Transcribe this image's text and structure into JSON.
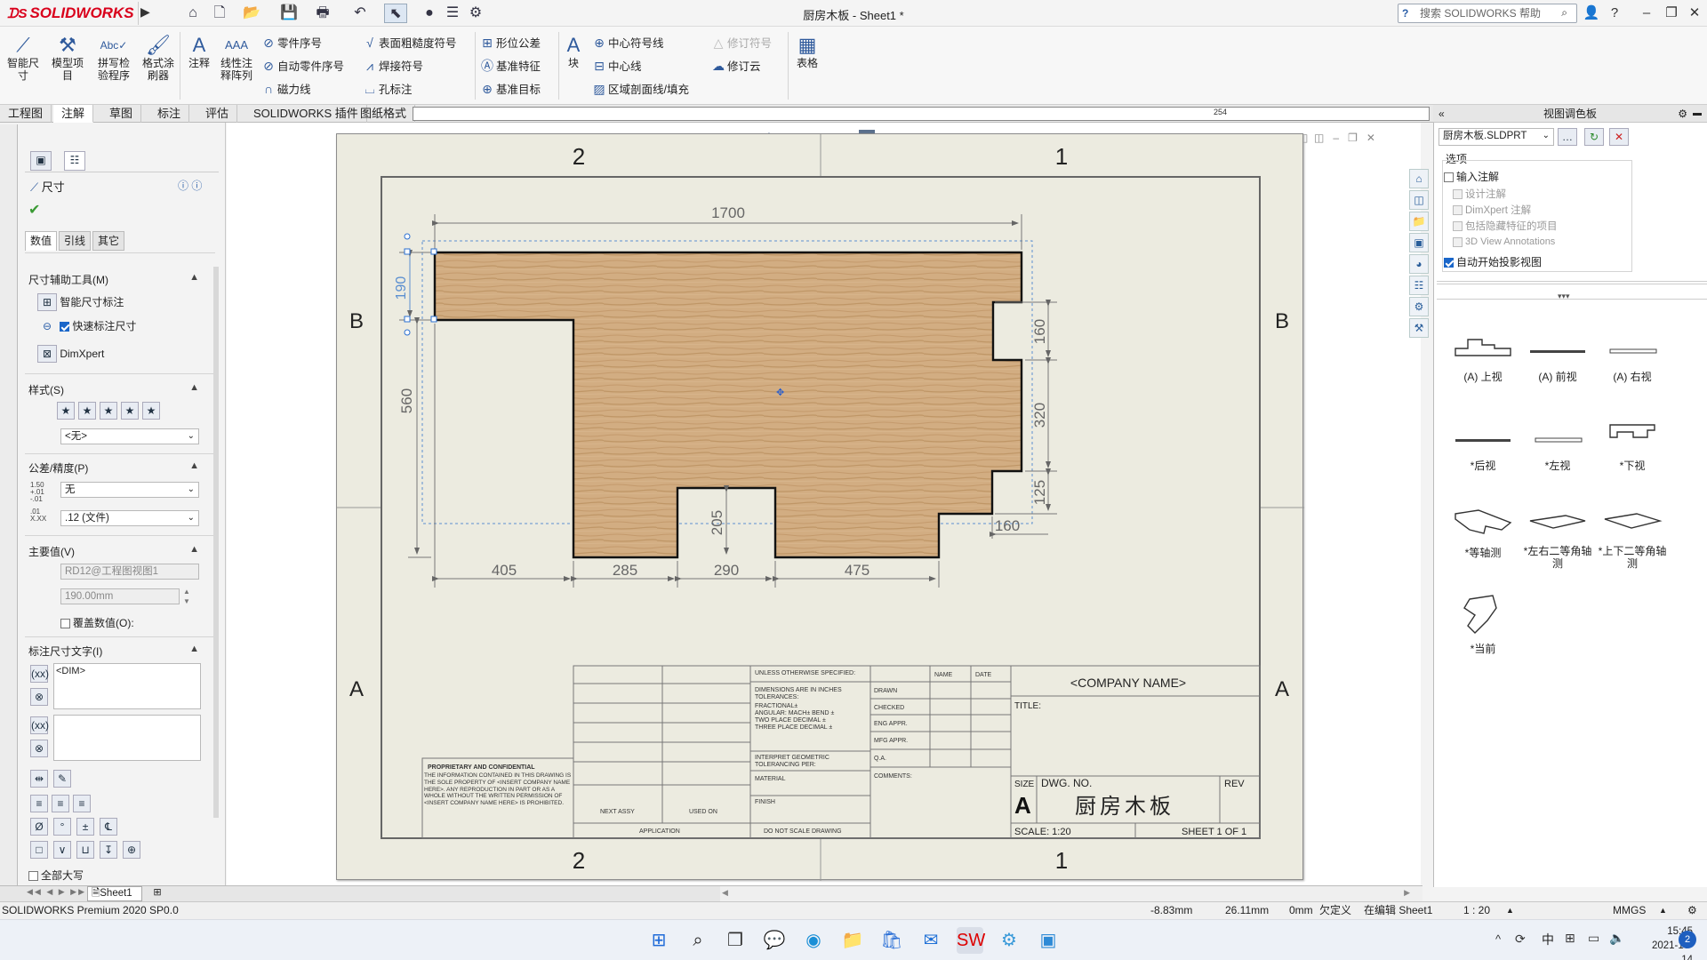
{
  "app": {
    "logo": "SOLIDWORKS",
    "doc_title": "厨房木板 - Sheet1 *",
    "help_placeholder": "搜索 SOLIDWORKS 帮助"
  },
  "ribbon": {
    "big": [
      {
        "label": "智能尺\n寸",
        "icon": "smart-dimension"
      },
      {
        "label": "模型项\n目",
        "icon": "model-items"
      },
      {
        "label": "拼写检\n验程序",
        "icon": "spell-check"
      },
      {
        "label": "格式涂\n刷器",
        "icon": "format-painter"
      },
      {
        "label": "注释",
        "icon": "note"
      },
      {
        "label": "线性注\n释阵列",
        "icon": "linear-note-pattern"
      }
    ],
    "col1": [
      "零件序号",
      "自动零件序号",
      "磁力线"
    ],
    "col2": [
      "表面粗糙度符号",
      "焊接符号",
      "孔标注"
    ],
    "col3": [
      "形位公差",
      "基准特征",
      "基准目标"
    ],
    "block_label": "块",
    "col4": [
      "中心符号线",
      "中心线",
      "区域剖面线/填充"
    ],
    "col5": [
      "修订符号",
      "修订云"
    ],
    "table_label": "表格"
  },
  "tabs": [
    "工程图",
    "注解",
    "草图",
    "标注",
    "评估",
    "SOLIDWORKS 插件",
    "图纸格式"
  ],
  "active_tab": "注解",
  "ruler_mark": "254",
  "left_panel": {
    "title": "尺寸",
    "subtabs": [
      "数值",
      "引线",
      "其它"
    ],
    "helper_title": "尺寸辅助工具(M)",
    "helper_items": [
      "智能尺寸标注",
      "快速标注尺寸",
      "DimXpert"
    ],
    "style_title": "样式(S)",
    "style_value": "<无>",
    "tol_title": "公差/精度(P)",
    "tol_value": "无",
    "prec_value": ".12 (文件)",
    "primary_title": "主要值(V)",
    "primary_ref": "RD12@工程图视图1",
    "primary_val": "190.00mm",
    "override_label": "覆盖数值(O):",
    "dimtext_title": "标注尺寸文字(I)",
    "dimtext_value": "<DIM>",
    "allcaps_label": "全部大写"
  },
  "drawing": {
    "zone_top": [
      "2",
      "1"
    ],
    "zone_side": [
      "B",
      "A"
    ],
    "dims": {
      "top": "1700",
      "left_small": "190",
      "left": "560",
      "right1": "160",
      "right2": "320",
      "right3": "125",
      "bottom_right": "160",
      "notch": "205",
      "b1": "405",
      "b2": "285",
      "b3": "290",
      "b4": "475"
    },
    "tb": {
      "unless": "UNLESS OTHERWISE SPECIFIED:",
      "dims_in": "DIMENSIONS ARE IN INCHES",
      "tolerances": "TOLERANCES:",
      "fractional": "FRACTIONAL±",
      "angular": "ANGULAR: MACH±    BEND ±",
      "two_place": "TWO PLACE DECIMAL   ±",
      "three_place": "THREE PLACE DECIMAL  ±",
      "interpret": "INTERPRET GEOMETRIC",
      "tolerancing": "TOLERANCING PER:",
      "material": "MATERIAL",
      "finish": "FINISH",
      "next_assy": "NEXT ASSY",
      "used_on": "USED ON",
      "application": "APPLICATION",
      "do_not_scale": "DO NOT SCALE DRAWING",
      "name": "NAME",
      "date": "DATE",
      "drawn": "DRAWN",
      "checked": "CHECKED",
      "eng": "ENG APPR.",
      "mfg": "MFG APPR.",
      "qa": "Q.A.",
      "comments": "COMMENTS:",
      "company": "<COMPANY NAME>",
      "title_lbl": "TITLE:",
      "size": "SIZE",
      "size_val": "A",
      "dwg_no": "DWG.  NO.",
      "dwg_title": "厨房木板",
      "rev": "REV",
      "scale": "SCALE: 1:20",
      "sheet": "SHEET 1 OF 1",
      "prop_title": "PROPRIETARY AND CONFIDENTIAL",
      "prop_text": "THE INFORMATION CONTAINED IN THIS DRAWING IS THE SOLE PROPERTY OF <INSERT COMPANY NAME HERE>. ANY REPRODUCTION IN PART OR AS A WHOLE WITHOUT THE WRITTEN PERMISSION OF <INSERT COMPANY NAME HERE> IS PROHIBITED."
    }
  },
  "right_pane": {
    "title": "视图调色板",
    "file": "厨房木板.SLDPRT",
    "options": "选项",
    "opts": [
      {
        "label": "输入注解",
        "checked": false,
        "enabled": true
      },
      {
        "label": "设计注解",
        "checked": false,
        "enabled": false
      },
      {
        "label": "DimXpert 注解",
        "checked": false,
        "enabled": false
      },
      {
        "label": "包括隐藏特征的项目",
        "checked": false,
        "enabled": false
      },
      {
        "label": "3D View Annotations",
        "checked": false,
        "enabled": false
      },
      {
        "label": "自动开始投影视图",
        "checked": true,
        "enabled": true
      }
    ],
    "views": [
      "(A) 上视",
      "(A) 前视",
      "(A) 右视",
      "*后视",
      "*左视",
      "*下视",
      "*等轴测",
      "*左右二等角轴测",
      "*上下二等角轴测",
      "*当前"
    ]
  },
  "sheet_tab": "Sheet1",
  "status": {
    "product": "SOLIDWORKS Premium 2020 SP0.0",
    "x": "-8.83mm",
    "y": "26.11mm",
    "z": "0mm",
    "state": "欠定义",
    "editing": "在编辑 Sheet1",
    "scale": "1 : 20",
    "units": "MMGS"
  },
  "taskbar": {
    "ime": "中",
    "time": "15:45",
    "date": "2021-10-14",
    "badge": "2"
  }
}
